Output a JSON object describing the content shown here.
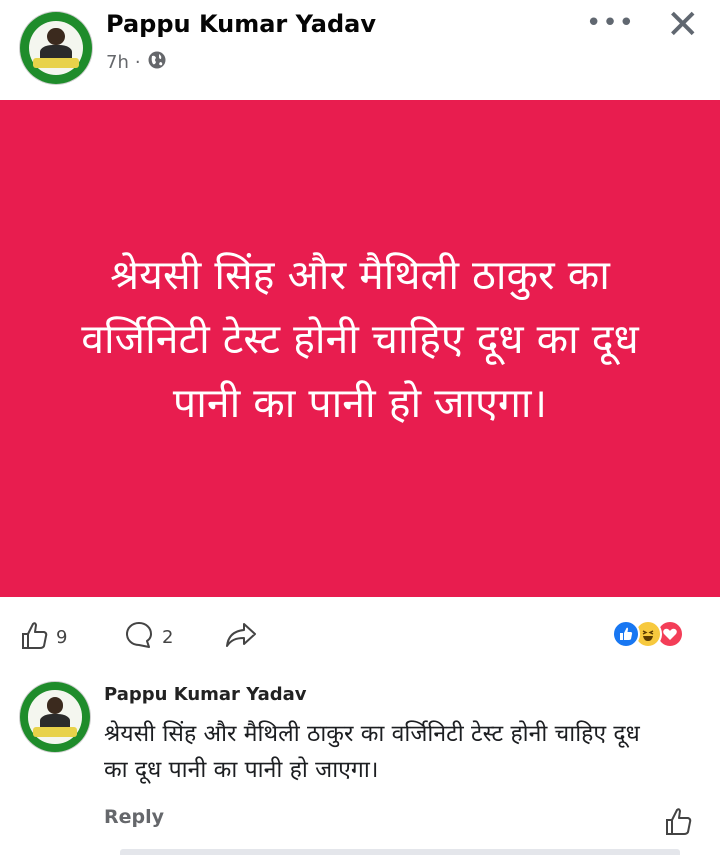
{
  "post": {
    "author": "Pappu Kumar Yadav",
    "time": "7h",
    "dot": "·",
    "more_label": "•••",
    "close_label": "✕",
    "body": "श्रेयसी सिंह और मैथिली ठाकुर का वर्जिनिटी टेस्ट होनी चाहिए दूध का दूध पानी का पानी हो जाएगा।",
    "background_color": "#e81d4f"
  },
  "actions": {
    "like_count": "9",
    "comment_count": "2"
  },
  "reactions": [
    "like-icon",
    "haha-icon",
    "love-icon"
  ],
  "comment": {
    "author": "Pappu Kumar Yadav",
    "text": "श्रेयसी सिंह और मैथिली ठाकुर का वर्जिनिटी टेस्ट होनी चाहिए दूध का दूध पानी का पानी हो जाएगा।",
    "reply_label": "Reply"
  }
}
